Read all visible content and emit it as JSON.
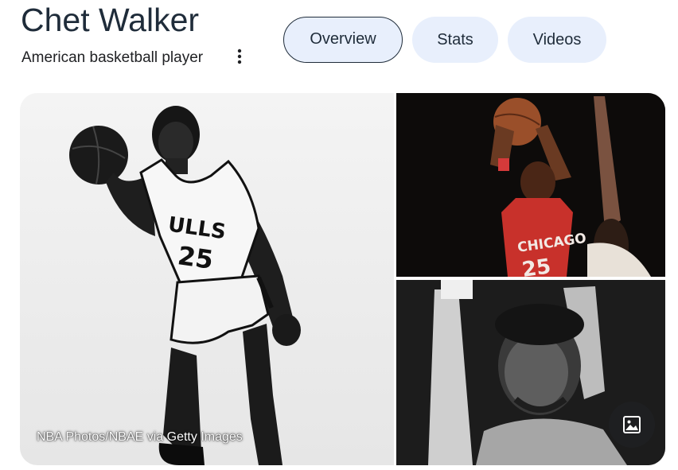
{
  "entity": {
    "title": "Chet Walker",
    "subtitle": "American basketball player"
  },
  "tabs": [
    {
      "label": "Overview",
      "active": true
    },
    {
      "label": "Stats",
      "active": false
    },
    {
      "label": "Videos",
      "active": false
    }
  ],
  "gallery": {
    "main_caption": "NBA Photos/NBAE via Getty Images",
    "jersey_main": "ULLS",
    "number_main": "25",
    "jersey_top": "CHICAGO",
    "number_top": "25"
  },
  "icons": {
    "more": "more-vert-icon",
    "image_search": "image-icon"
  },
  "colors": {
    "chip_bg": "#e8effc",
    "title_text": "#1f2c3a",
    "jersey_red": "#c8312b"
  }
}
